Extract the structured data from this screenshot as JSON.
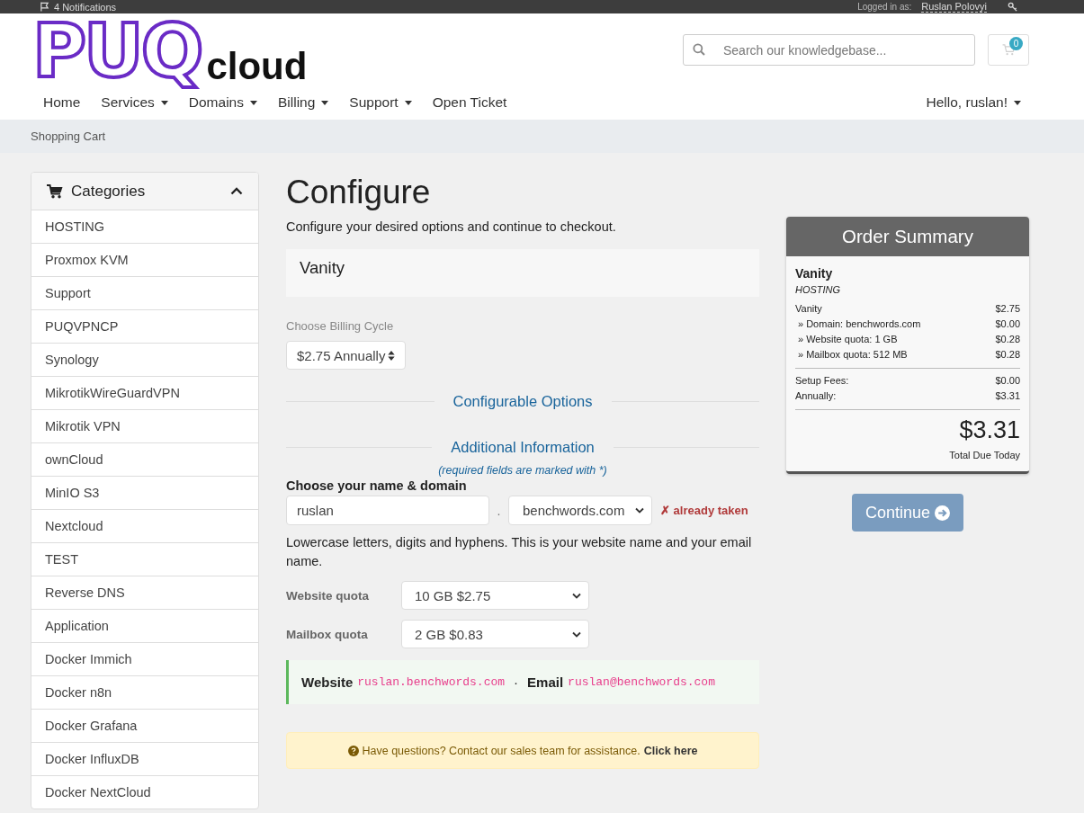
{
  "top_bar": {
    "notifications": "4 Notifications",
    "logged_in_label": "Logged in as:",
    "user_name": "Ruslan Polovyi"
  },
  "header": {
    "logo": {
      "brand": "PUQ",
      "suffix": "cloud"
    },
    "search": {
      "placeholder": "Search our knowledgebase..."
    },
    "cart": {
      "count": "0"
    }
  },
  "nav": {
    "items": [
      {
        "label": "Home",
        "dropdown": false
      },
      {
        "label": "Services",
        "dropdown": true
      },
      {
        "label": "Domains",
        "dropdown": true
      },
      {
        "label": "Billing",
        "dropdown": true
      },
      {
        "label": "Support",
        "dropdown": true
      },
      {
        "label": "Open Ticket",
        "dropdown": false
      }
    ],
    "user_menu": {
      "label": "Hello, ruslan!",
      "dropdown": true
    }
  },
  "breadcrumb": [
    "Shopping Cart"
  ],
  "sidebar": {
    "title": "Categories",
    "expanded": true,
    "items": [
      {
        "label": "HOSTING",
        "selected": false
      },
      {
        "label": "Proxmox KVM",
        "selected": false
      },
      {
        "label": "Support",
        "selected": false
      },
      {
        "label": "PUQVPNCP",
        "selected": false
      },
      {
        "label": "Synology",
        "selected": false
      },
      {
        "label": "MikrotikWireGuardVPN",
        "selected": false
      },
      {
        "label": "Mikrotik VPN",
        "selected": false
      },
      {
        "label": "ownCloud",
        "selected": false
      },
      {
        "label": "MinIO S3",
        "selected": false
      },
      {
        "label": "Nextcloud",
        "selected": false
      },
      {
        "label": "TEST",
        "selected": false
      },
      {
        "label": "Reverse DNS",
        "selected": false
      },
      {
        "label": "Application",
        "selected": false
      },
      {
        "label": "Docker Immich",
        "selected": false
      },
      {
        "label": "Docker n8n",
        "selected": false
      },
      {
        "label": "Docker Grafana",
        "selected": false
      },
      {
        "label": "Docker InfluxDB",
        "selected": false
      },
      {
        "label": "Docker NextCloud",
        "selected": false
      }
    ]
  },
  "main": {
    "title": "Configure",
    "subtitle": "Configure your desired options and continue to checkout.",
    "product": {
      "name": "Vanity"
    },
    "billing": {
      "label": "Choose Billing Cycle",
      "value": "$2.75 Annually"
    },
    "configurable_options": {
      "heading": "Configurable Options"
    },
    "additional_info": {
      "heading": "Additional Information",
      "note": "(required fields are marked with *)",
      "domain_field": {
        "label": "Choose your name & domain",
        "name_value": "ruslan",
        "separator": ".",
        "domain_value": "benchwords.com",
        "status": "✗ already taken",
        "help": "Lowercase letters, digits and hyphens. This is your website name and your email name."
      },
      "quotas": [
        {
          "label": "Website quota",
          "value": "10 GB $2.75"
        },
        {
          "label": "Mailbox quota",
          "value": "2 GB $0.83"
        }
      ],
      "preview": {
        "items": [
          {
            "label": "Website",
            "value": "ruslan.benchwords.com"
          },
          {
            "label": "Email",
            "value": "ruslan@benchwords.com"
          }
        ],
        "separator": "·"
      }
    },
    "help_alert": {
      "text": "Have questions? Contact our sales team for assistance.",
      "link": "Click here"
    }
  },
  "order_summary": {
    "title": "Order Summary",
    "product": "Vanity",
    "group": "HOSTING",
    "lines": [
      {
        "kind": "item",
        "label": "Vanity",
        "amount": "$2.75"
      },
      {
        "kind": "option",
        "label": "» Domain: benchwords.com",
        "amount": "$0.00"
      },
      {
        "kind": "option",
        "label": "» Website quota: 1 GB",
        "amount": "$0.28"
      },
      {
        "kind": "option",
        "label": "» Mailbox quota: 512 MB",
        "amount": "$0.28"
      }
    ],
    "totals": [
      {
        "label": "Setup Fees:",
        "amount": "$0.00"
      },
      {
        "label": "Annually:",
        "amount": "$3.31"
      }
    ],
    "total": "$3.31",
    "total_label": "Total Due Today"
  },
  "continue_button": {
    "label": "Continue",
    "disabled": true
  }
}
